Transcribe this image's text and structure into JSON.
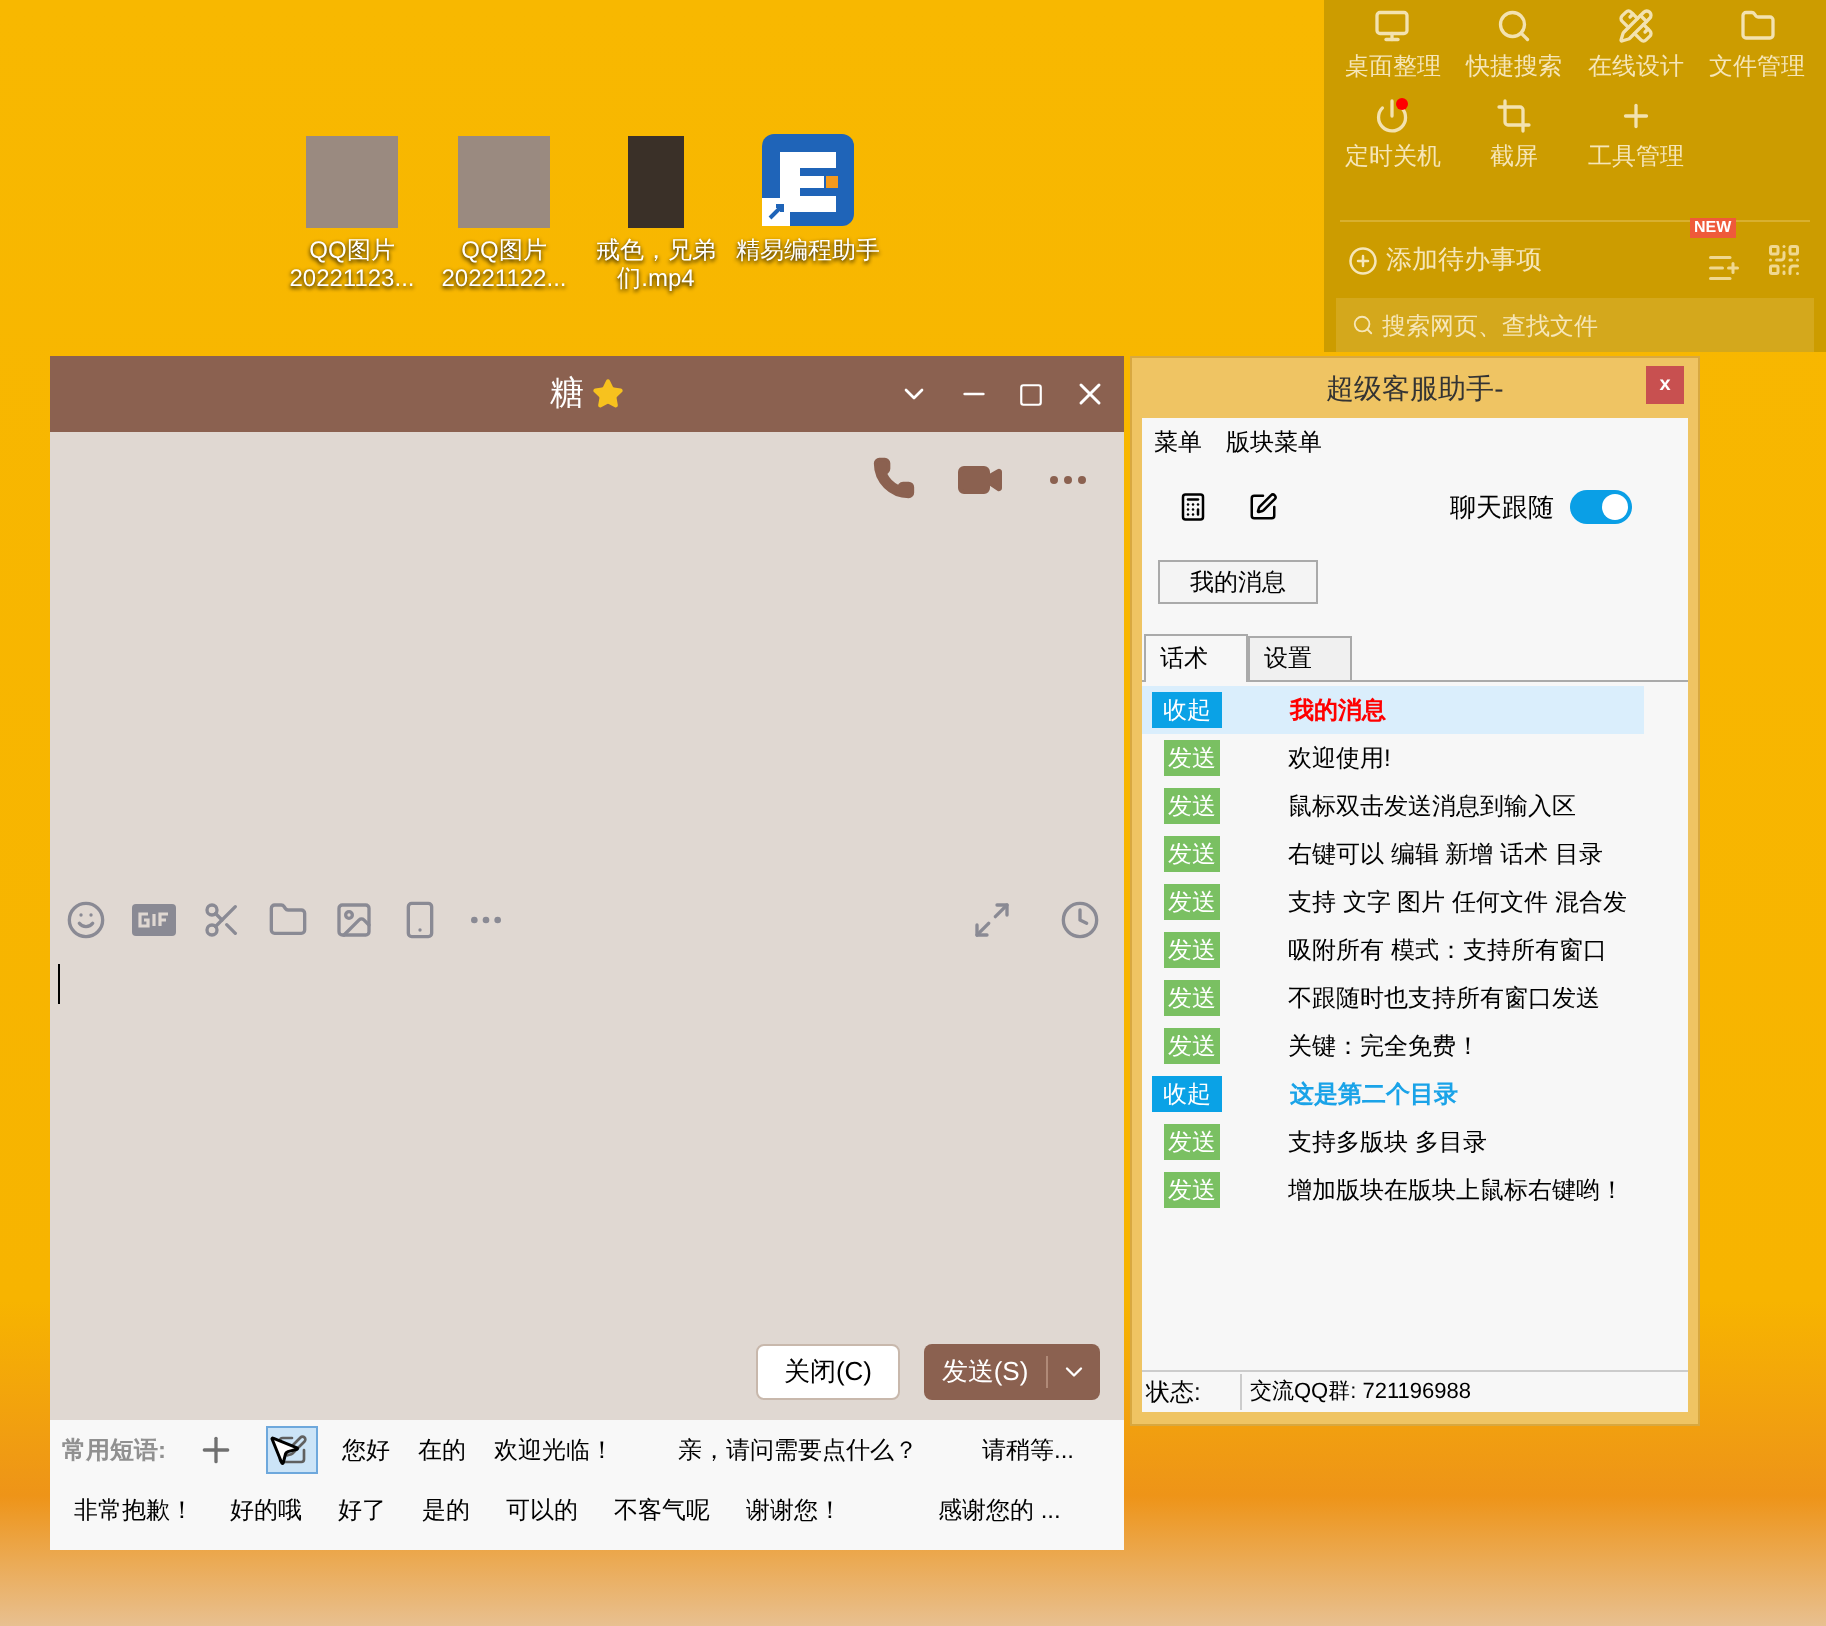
{
  "quick_panel": {
    "tools": [
      {
        "label": "桌面整理",
        "notify": false
      },
      {
        "label": "快捷搜索",
        "notify": false
      },
      {
        "label": "在线设计",
        "notify": false
      },
      {
        "label": "文件管理",
        "notify": false
      },
      {
        "label": "定时关机",
        "notify": true
      },
      {
        "label": "截屏",
        "notify": false
      },
      {
        "label": "工具管理",
        "notify": false
      }
    ],
    "todo": "添加待办事项",
    "new_badge": "NEW",
    "search_placeholder": "搜索网页、查找文件"
  },
  "desktop_icons": [
    {
      "kind": "photo",
      "lines": [
        "QQ图片",
        "20221123..."
      ]
    },
    {
      "kind": "photo",
      "lines": [
        "QQ图片",
        "20221122..."
      ]
    },
    {
      "kind": "video",
      "lines": [
        "戒色，兄弟",
        "们.mp4"
      ]
    },
    {
      "kind": "app",
      "lines": [
        "精易编程助手"
      ]
    }
  ],
  "chat": {
    "title": "糖",
    "close_button": "关闭(C)",
    "send_button": "发送(S)",
    "phrases_label": "常用短语:",
    "phrase_tools": [
      {
        "kind": "add",
        "selected": false
      },
      {
        "kind": "insert",
        "selected": true
      }
    ],
    "phrases_row1": [
      "您好",
      "在的",
      "欢迎光临！",
      "亲，请问需要点什么？",
      "请稍等..."
    ],
    "phrases_row2": [
      "非常抱歉！",
      "好的哦",
      "好了",
      "是的",
      "可以的",
      "不客气呢",
      "谢谢您！",
      "感谢您的 ..."
    ]
  },
  "helper": {
    "title": "超级客服助手-",
    "close": "x",
    "menus": [
      "菜单",
      "版块菜单"
    ],
    "follow": {
      "label": "聊天跟随",
      "on": true
    },
    "my_messages_button": "我的消息",
    "tabs": [
      {
        "label": "话术",
        "selected": true
      },
      {
        "label": "设置",
        "selected": false
      }
    ],
    "rows": [
      {
        "kind": "folder",
        "button": "收起",
        "text": "我的消息",
        "color": "#ff0000",
        "selected": true
      },
      {
        "kind": "phrase",
        "button": "发送",
        "text": "欢迎使用!",
        "selected": false
      },
      {
        "kind": "phrase",
        "button": "发送",
        "text": "鼠标双击发送消息到输入区",
        "selected": false
      },
      {
        "kind": "phrase",
        "button": "发送",
        "text": "右键可以 编辑 新增 话术 目录",
        "selected": false
      },
      {
        "kind": "phrase",
        "button": "发送",
        "text": "支持 文字 图片 任何文件 混合发",
        "selected": false
      },
      {
        "kind": "phrase",
        "button": "发送",
        "text": "吸附所有 模式：支持所有窗口",
        "selected": false
      },
      {
        "kind": "phrase",
        "button": "发送",
        "text": "不跟随时也支持所有窗口发送",
        "selected": false
      },
      {
        "kind": "phrase",
        "button": "发送",
        "text": "关键：完全免费！",
        "selected": false
      },
      {
        "kind": "folder",
        "button": "收起",
        "text": "这是第二个目录",
        "color": "#1aa3e8",
        "selected": false
      },
      {
        "kind": "phrase",
        "button": "发送",
        "text": "支持多版块 多目录",
        "selected": false
      },
      {
        "kind": "phrase",
        "button": "发送",
        "text": "增加版块在版块上鼠标右键哟！",
        "selected": false
      }
    ],
    "status_label": "状态:",
    "status_text": "交流QQ群: 721196988"
  }
}
